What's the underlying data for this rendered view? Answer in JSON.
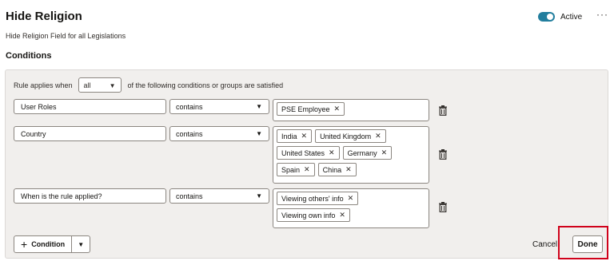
{
  "header": {
    "title": "Hide Religion",
    "subtitle": "Hide Religion Field for all Legislations",
    "status_label": "Active",
    "status_active": true,
    "more_label": "···"
  },
  "conditions": {
    "heading": "Conditions",
    "rule_prefix": "Rule applies when",
    "match_value": "all",
    "rule_suffix": "of the following conditions or groups are satisfied",
    "rows": [
      {
        "field": "User Roles",
        "operator": "contains",
        "values": [
          "PSE Employee"
        ]
      },
      {
        "field": "Country",
        "operator": "contains",
        "values": [
          "India",
          "United Kingdom",
          "United States",
          "Germany",
          "Spain",
          "China"
        ]
      },
      {
        "field": "When is the rule applied?",
        "operator": "contains",
        "values": [
          "Viewing others' info",
          "Viewing own info"
        ]
      }
    ]
  },
  "footer": {
    "add_condition_label": "Condition",
    "cancel_label": "Cancel",
    "done_label": "Done"
  },
  "colors": {
    "accent": "#227e9e",
    "highlight": "#d0021b",
    "panel_bg": "#f1efed"
  }
}
